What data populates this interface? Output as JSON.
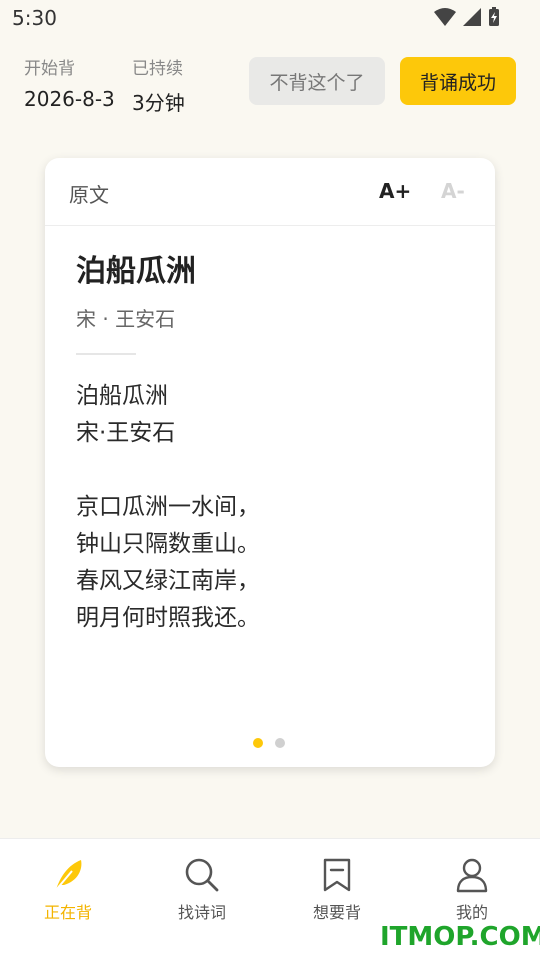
{
  "status_bar": {
    "time": "5:30"
  },
  "header": {
    "start_label": "开始背",
    "start_value": "2026-8-3",
    "duration_label": "已持续",
    "duration_value": "3分钟",
    "skip_label": "不背这个了",
    "success_label": "背诵成功"
  },
  "card": {
    "tab_label": "原文",
    "font_increase": "A+",
    "font_decrease": "A-",
    "title": "泊船瓜洲",
    "author": "宋 · 王安石",
    "lines": [
      "泊船瓜洲",
      "宋·王安石",
      "",
      "京口瓜洲一水间，",
      "钟山只隔数重山。",
      "春风又绿江南岸，",
      "明月何时照我还。"
    ],
    "page_count": 2,
    "current_page": 1
  },
  "tabbar": {
    "items": [
      {
        "label": "正在背",
        "icon": "feather-icon",
        "active": true
      },
      {
        "label": "找诗词",
        "icon": "search-icon",
        "active": false
      },
      {
        "label": "想要背",
        "icon": "bookmark-icon",
        "active": false
      },
      {
        "label": "我的",
        "icon": "person-icon",
        "active": false
      }
    ]
  },
  "watermark": "ITMOP.COM",
  "colors": {
    "accent": "#fdc80a",
    "active_tab": "#f3b400",
    "background": "#faf8f1"
  }
}
